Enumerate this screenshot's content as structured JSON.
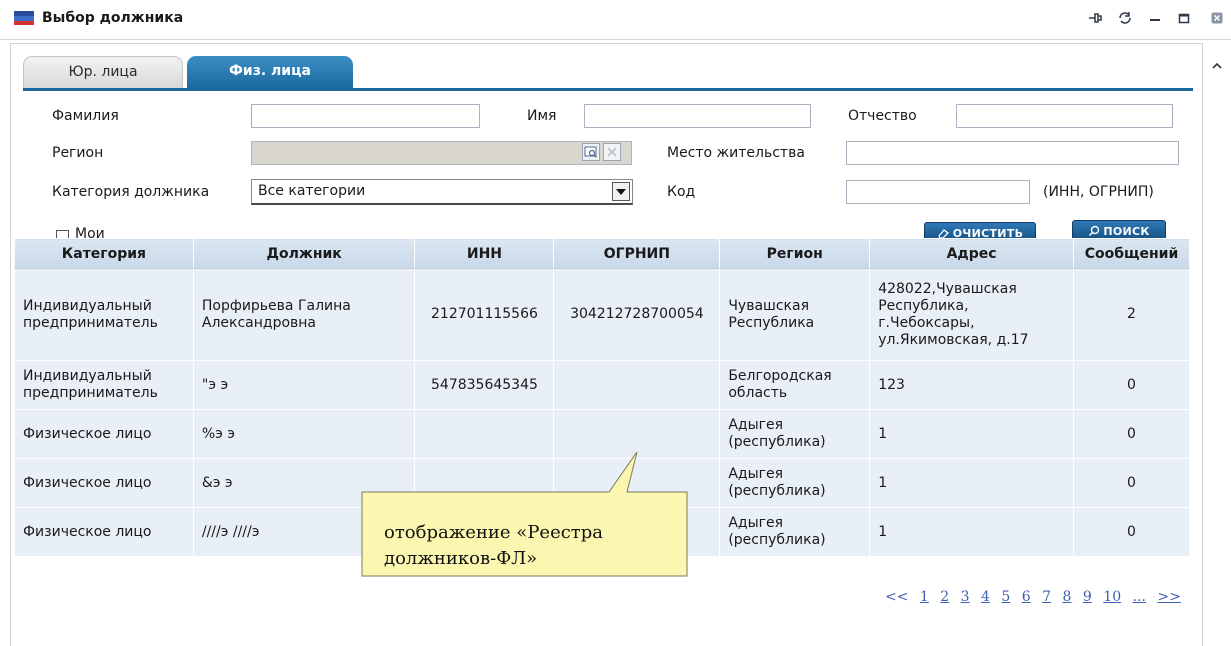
{
  "window": {
    "title": "Выбор должника"
  },
  "tabs": [
    {
      "label": "Юр. лица",
      "active": false
    },
    {
      "label": "Физ. лица",
      "active": true
    }
  ],
  "form": {
    "surname": {
      "label": "Фамилия",
      "value": ""
    },
    "name": {
      "label": "Имя",
      "value": ""
    },
    "patronymic": {
      "label": "Отчество",
      "value": ""
    },
    "region": {
      "label": "Регион",
      "value": ""
    },
    "residence": {
      "label": "Место жительства",
      "value": ""
    },
    "category": {
      "label": "Категория должника",
      "value": "Все категории"
    },
    "code": {
      "label": "Код",
      "value": "",
      "hint": "(ИНН, ОГРНИП)"
    },
    "mine": {
      "label": "Мои",
      "checked": false
    },
    "clear_label": "ОЧИСТИТЬ",
    "search_label": "ПОИСК"
  },
  "table": {
    "columns": [
      "Категория",
      "Должник",
      "ИНН",
      "ОГРНИП",
      "Регион",
      "Адрес",
      "Сообщений"
    ],
    "rows": [
      {
        "category": "Индивидуальный предприниматель",
        "debtor": "Порфирьева Галина Александровна",
        "inn": "212701115566",
        "ogrnip": "304212728700054",
        "region": "Чувашская Республика",
        "address": "428022,Чувашская Республика, г.Чебоксары, ул.Якимовская, д.17",
        "messages": "2"
      },
      {
        "category": "Индивидуальный предприниматель",
        "debtor": "\"э э",
        "inn": "547835645345",
        "ogrnip": "",
        "region": "Белгородская область",
        "address": "123",
        "messages": "0"
      },
      {
        "category": "Физическое лицо",
        "debtor": "%э э",
        "inn": "",
        "ogrnip": "",
        "region": "Адыгея (республика)",
        "address": "1",
        "messages": "0"
      },
      {
        "category": "Физическое лицо",
        "debtor": "&э э",
        "inn": "",
        "ogrnip": "",
        "region": "Адыгея (республика)",
        "address": "1",
        "messages": "0"
      },
      {
        "category": "Физическое лицо",
        "debtor": "////э ////э",
        "inn": "",
        "ogrnip": "",
        "region": "Адыгея (республика)",
        "address": "1",
        "messages": "0"
      }
    ]
  },
  "pager": {
    "prev": "<<",
    "pages": [
      "1",
      "2",
      "3",
      "4",
      "5",
      "6",
      "7",
      "8",
      "9",
      "10"
    ],
    "more": "...",
    "next": ">>"
  },
  "callout": {
    "text": "отображение «Реестра должников-ФЛ»"
  },
  "colors": {
    "accent": "#1c6aa0",
    "header_bg": "#d2dfed",
    "row_bg": "#e9eff6",
    "callout_bg": "#fbf7b0",
    "link": "#3d5fb0"
  },
  "icons": [
    "app-flag-icon",
    "pin-icon",
    "refresh-icon",
    "minimize-icon",
    "maximize-icon",
    "close-icon",
    "lookup-icon",
    "clear-field-icon",
    "dropdown-arrow-icon",
    "eraser-icon",
    "magnifier-icon",
    "scroll-up-icon"
  ]
}
